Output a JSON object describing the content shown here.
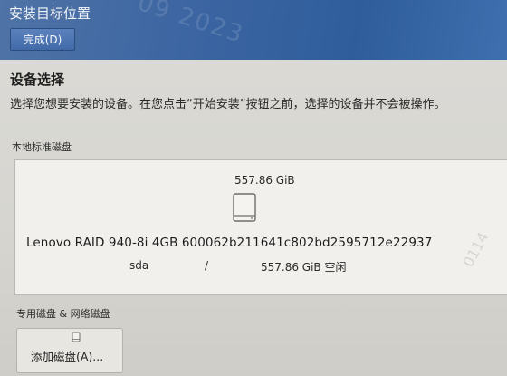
{
  "header": {
    "title": "安装目标位置",
    "done_label": "完成(D)",
    "watermark": "09 2023"
  },
  "device_selection": {
    "title": "设备选择",
    "description": "选择您想要安装的设备。在您点击“开始安装”按钮之前，选择的设备并不会被操作。"
  },
  "local_disks": {
    "label": "本地标准磁盘",
    "disks": [
      {
        "size": "557.86 GiB",
        "name": "Lenovo RAID 940-8i 4GB 600062b211641c802bd2595712e22937",
        "device": "sda",
        "mount": "/",
        "free": "557.86 GiB 空闲",
        "icon": "hard-disk-icon"
      }
    ]
  },
  "side_watermark": "0114",
  "specialized": {
    "label": "专用磁盘 & 网络磁盘",
    "add_disk_label": "添加磁盘(A)...",
    "add_disk_icon": "disk-add-icon"
  },
  "colors": {
    "header_blue": "#3d66a2",
    "button_blue": "#4a72b0",
    "background": "#d9d8d3",
    "panel": "#f1f0ec"
  }
}
